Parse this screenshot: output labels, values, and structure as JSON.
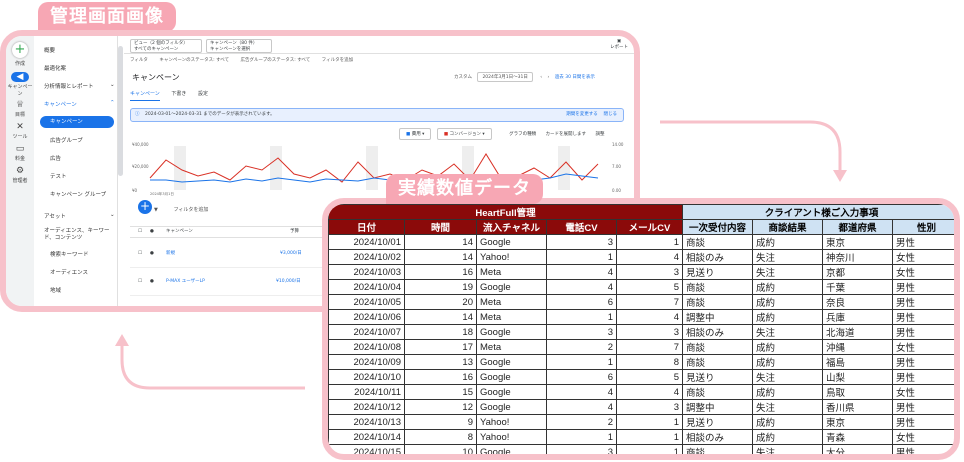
{
  "labels": {
    "admin": "管理画面画像",
    "results": "実績数値データ"
  },
  "colors": {
    "frame": "#f7c1ca",
    "tag": "#f7a7b4",
    "heartfull_header": "#8b0a0a",
    "client_header": "#cfe2f3"
  },
  "gads": {
    "rail": [
      {
        "icon": "plus-icon",
        "label": "作成"
      },
      {
        "icon": "megaphone-icon",
        "label": "キャンペーン"
      },
      {
        "icon": "trophy-icon",
        "label": "目標"
      },
      {
        "icon": "tools-icon",
        "label": "ツール"
      },
      {
        "icon": "billing-icon",
        "label": "料金"
      },
      {
        "icon": "gear-icon",
        "label": "管理者"
      }
    ],
    "nav": {
      "overview": "概要",
      "recommendations": "最適化案",
      "insights": "分析情報とレポート",
      "campaigns_group": "キャンペーン",
      "campaigns": "キャンペーン",
      "ad_groups": "広告グループ",
      "ads": "広告",
      "test": "テスト",
      "campaign_groups": "キャンペーン グループ",
      "assets": "アセット",
      "audiences": "オーディエンス、キーワード、コンテンツ",
      "search_keywords": "検索キーワード",
      "audience": "オーディエンス",
      "location": "地域"
    },
    "view_selector": {
      "label": "ビュー（2 個のフィルタ）",
      "value": "すべてのキャンペーン"
    },
    "campaign_selector": {
      "label": "キャンペーン（80 件）",
      "value": "キャンペーンを選択"
    },
    "filters": [
      "フィルタ",
      "キャンペーンのステータス: すべて",
      "広告グループのステータス: すべて",
      "フィルタを追加"
    ],
    "report_label": "レポート",
    "page_title": "キャンペーン",
    "date_label": "カスタム",
    "date_range": "2024年3月1日～31日",
    "date_link": "過去 30 日間を表示",
    "tabs": [
      "キャンペーン",
      "下書き",
      "設定"
    ],
    "notice": "2024-03-01～2024-03-31 までのデータが表示されています。",
    "notice_links": [
      "期間を変更する",
      "閉じる"
    ],
    "metric1": "費用",
    "metric2": "コンバージョン",
    "chart_tools": [
      "グラフの種類",
      "カードを展開します",
      "調整"
    ],
    "y_left": [
      "¥40,000",
      "¥20,000",
      "¥0"
    ],
    "y_right": [
      "14.00",
      "7.00",
      "0.00"
    ],
    "x_first": "2024年3月1日",
    "add_filter": "フィルタを追加",
    "table_header_campaign": "キャンペーン",
    "table_header_budget": "予算",
    "rows": [
      {
        "name": "新規",
        "budget": "¥3,000/日"
      },
      {
        "name": "P-MAX ユーザーLP",
        "budget": "¥10,000/日"
      }
    ]
  },
  "results_table": {
    "group_heartfull": "HeartFull管理",
    "group_client": "クライアント様ご入力事項",
    "columns": [
      "日付",
      "時間",
      "流入チャネル",
      "電話CV",
      "メールCV",
      "一次受付内容",
      "商談結果",
      "都道府県",
      "性別"
    ],
    "rows": [
      [
        "2024/10/01",
        "14",
        "Google",
        "3",
        "1",
        "商談",
        "成約",
        "東京",
        "男性"
      ],
      [
        "2024/10/02",
        "14",
        "Yahoo!",
        "1",
        "4",
        "相談のみ",
        "失注",
        "神奈川",
        "女性"
      ],
      [
        "2024/10/03",
        "16",
        "Meta",
        "4",
        "3",
        "見送り",
        "失注",
        "京都",
        "女性"
      ],
      [
        "2024/10/04",
        "19",
        "Google",
        "4",
        "5",
        "商談",
        "成約",
        "千葉",
        "男性"
      ],
      [
        "2024/10/05",
        "20",
        "Meta",
        "6",
        "7",
        "商談",
        "成約",
        "奈良",
        "男性"
      ],
      [
        "2024/10/06",
        "14",
        "Meta",
        "1",
        "4",
        "調整中",
        "成約",
        "兵庫",
        "男性"
      ],
      [
        "2024/10/07",
        "18",
        "Google",
        "3",
        "3",
        "相談のみ",
        "失注",
        "北海道",
        "男性"
      ],
      [
        "2024/10/08",
        "17",
        "Meta",
        "2",
        "7",
        "商談",
        "成約",
        "沖縄",
        "女性"
      ],
      [
        "2024/10/09",
        "13",
        "Google",
        "1",
        "8",
        "商談",
        "成約",
        "福島",
        "男性"
      ],
      [
        "2024/10/10",
        "16",
        "Google",
        "6",
        "5",
        "見送り",
        "失注",
        "山梨",
        "男性"
      ],
      [
        "2024/10/11",
        "15",
        "Google",
        "4",
        "4",
        "商談",
        "成約",
        "鳥取",
        "女性"
      ],
      [
        "2024/10/12",
        "12",
        "Google",
        "4",
        "3",
        "調整中",
        "失注",
        "香川県",
        "男性"
      ],
      [
        "2024/10/13",
        "9",
        "Yahoo!",
        "2",
        "1",
        "見送り",
        "成約",
        "東京",
        "男性"
      ],
      [
        "2024/10/14",
        "8",
        "Yahoo!",
        "1",
        "1",
        "相談のみ",
        "成約",
        "青森",
        "女性"
      ],
      [
        "2024/10/15",
        "10",
        "Google",
        "3",
        "1",
        "商談",
        "失注",
        "大分",
        "男性"
      ]
    ]
  }
}
